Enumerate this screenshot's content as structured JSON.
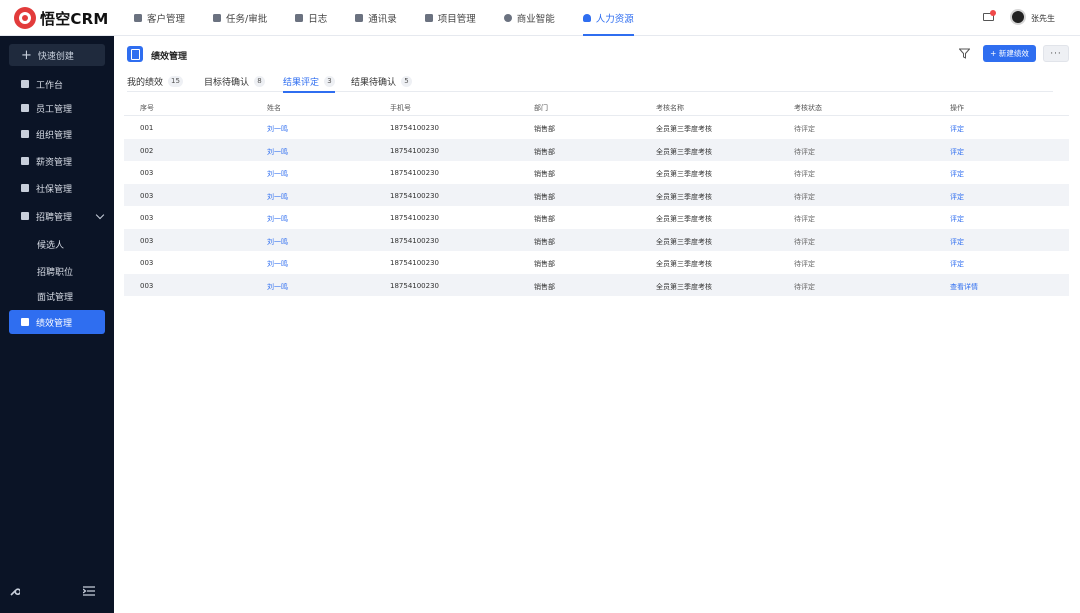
{
  "app": {
    "logo_text": "悟空CRM"
  },
  "topnav": [
    {
      "label": "客户管理",
      "active": false
    },
    {
      "label": "任务/审批",
      "active": false
    },
    {
      "label": "日志",
      "active": false
    },
    {
      "label": "通讯录",
      "active": false
    },
    {
      "label": "项目管理",
      "active": false
    },
    {
      "label": "商业智能",
      "active": false
    },
    {
      "label": "人力资源",
      "active": true
    }
  ],
  "user": {
    "name": "张先生"
  },
  "sidebar": {
    "quick_create": "快速创建",
    "items": [
      {
        "label": "工作台"
      },
      {
        "label": "员工管理"
      },
      {
        "label": "组织管理"
      },
      {
        "label": "薪资管理"
      },
      {
        "label": "社保管理"
      },
      {
        "label": "招聘管理"
      },
      {
        "label": "候选人"
      },
      {
        "label": "招聘职位"
      },
      {
        "label": "面试管理"
      },
      {
        "label": "绩效管理"
      }
    ]
  },
  "page": {
    "title": "绩效管理",
    "new_button": "+ 新建绩效",
    "more_button": "···"
  },
  "tabs": [
    {
      "label": "我的绩效",
      "count": "15"
    },
    {
      "label": "目标待确认",
      "count": "8"
    },
    {
      "label": "结果评定",
      "count": "3"
    },
    {
      "label": "结果待确认",
      "count": "5"
    }
  ],
  "table": {
    "headers": [
      "序号",
      "姓名",
      "手机号",
      "部门",
      "考核名称",
      "考核状态",
      "操作"
    ],
    "rows": [
      [
        "001",
        "刘一鸣",
        "18754100230",
        "销售部",
        "全员第三季度考核",
        "待评定",
        "评定"
      ],
      [
        "002",
        "刘一鸣",
        "18754100230",
        "销售部",
        "全员第三季度考核",
        "待评定",
        "评定"
      ],
      [
        "003",
        "刘一鸣",
        "18754100230",
        "销售部",
        "全员第三季度考核",
        "待评定",
        "评定"
      ],
      [
        "003",
        "刘一鸣",
        "18754100230",
        "销售部",
        "全员第三季度考核",
        "待评定",
        "评定"
      ],
      [
        "003",
        "刘一鸣",
        "18754100230",
        "销售部",
        "全员第三季度考核",
        "待评定",
        "评定"
      ],
      [
        "003",
        "刘一鸣",
        "18754100230",
        "销售部",
        "全员第三季度考核",
        "待评定",
        "评定"
      ],
      [
        "003",
        "刘一鸣",
        "18754100230",
        "销售部",
        "全员第三季度考核",
        "待评定",
        "评定"
      ],
      [
        "003",
        "刘一鸣",
        "18754100230",
        "销售部",
        "全员第三季度考核",
        "待评定",
        "查看详情"
      ]
    ]
  },
  "colors": {
    "accent": "#2f6ef0",
    "sidebar_bg": "#0b1426",
    "row_alt": "#f1f3f7"
  }
}
